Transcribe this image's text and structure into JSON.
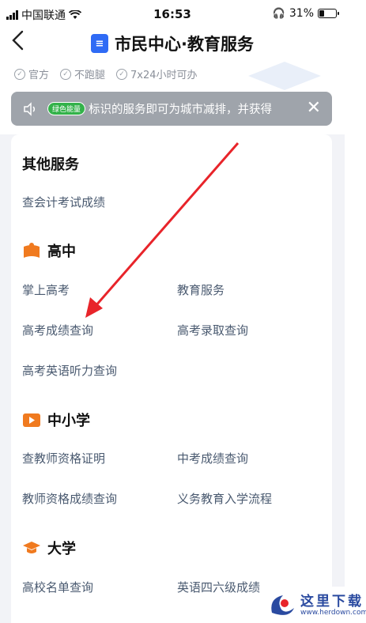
{
  "status_bar": {
    "carrier": "中国联通",
    "time": "16:53",
    "battery": "31%",
    "battery_level": 0.31
  },
  "header": {
    "back_icon": "chevron-left-icon",
    "title": "市民中心·教育服务",
    "tags": [
      "官方",
      "不跑腿",
      "7x24小时可办"
    ]
  },
  "notice": {
    "badge": "绿色能量",
    "text": "标识的服务即可为城市减排，并获得",
    "speaker_icon": "speaker-icon",
    "close_icon": "close-icon"
  },
  "sections": {
    "other": {
      "title": "其他服务",
      "items": [
        "查会计考试成绩"
      ]
    },
    "high": {
      "title": "高中",
      "icon": "book-icon",
      "items": [
        "掌上高考",
        "教育服务",
        "高考成绩查询",
        "高考录取查询",
        "高考英语听力查询"
      ]
    },
    "middle": {
      "title": "中小学",
      "icon": "play-icon",
      "items": [
        "查教师资格证明",
        "中考成绩查询",
        "教师资格成绩查询",
        "义务教育入学流程"
      ]
    },
    "univ": {
      "title": "大学",
      "icon": "graduation-cap-icon",
      "items": [
        "高校名单查询",
        "英语四六级成绩"
      ]
    }
  },
  "watermark": {
    "title": "这里下载",
    "url": "www.herdown.com"
  },
  "colors": {
    "accent": "#2f6bf5",
    "orange": "#f07a1f",
    "green": "#33b24a",
    "arrow": "#e8242a"
  }
}
